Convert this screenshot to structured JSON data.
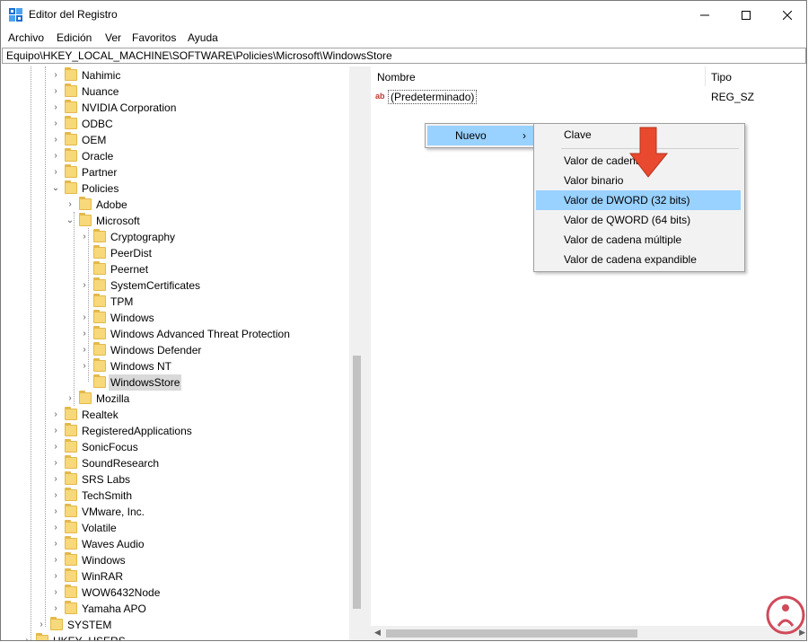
{
  "window": {
    "title": "Editor del Registro"
  },
  "menu": [
    "Archivo",
    "Edición",
    "Ver",
    "Favoritos",
    "Ayuda"
  ],
  "address": "Equipo\\HKEY_LOCAL_MACHINE\\SOFTWARE\\Policies\\Microsoft\\WindowsStore",
  "tree": {
    "level1_top": [
      "Nahimic",
      "Nuance",
      "NVIDIA Corporation",
      "ODBC",
      "OEM",
      "Oracle",
      "Partner"
    ],
    "policies": "Policies",
    "policies_children": [
      "Adobe"
    ],
    "microsoft": "Microsoft",
    "microsoft_children": [
      "Cryptography",
      "PeerDist",
      "Peernet",
      "SystemCertificates",
      "TPM",
      "Windows",
      "Windows Advanced Threat Protection",
      "Windows Defender",
      "Windows NT"
    ],
    "selected": "WindowsStore",
    "mozilla": "Mozilla",
    "level1_bottom": [
      "Realtek",
      "RegisteredApplications",
      "SonicFocus",
      "SoundResearch",
      "SRS Labs",
      "TechSmith",
      "VMware, Inc.",
      "Volatile",
      "Waves Audio",
      "Windows",
      "WinRAR",
      "WOW6432Node",
      "Yamaha APO"
    ],
    "system": "SYSTEM",
    "hkey_users": "HKEY_USERS"
  },
  "list": {
    "columns": {
      "name": "Nombre",
      "type": "Tipo"
    },
    "rows": [
      {
        "name": "(Predeterminado)",
        "type": "REG_SZ"
      }
    ]
  },
  "context_menu": {
    "parent": "Nuevo",
    "items": [
      "Clave",
      "Valor de cadena",
      "Valor binario",
      "Valor de DWORD (32 bits)",
      "Valor de QWORD (64 bits)",
      "Valor de cadena múltiple",
      "Valor de cadena expandible"
    ],
    "highlighted": "Valor de DWORD (32 bits)"
  },
  "colors": {
    "highlight": "#99d1ff",
    "arrow": "#e8492f",
    "selection": "#d9d9d9"
  }
}
